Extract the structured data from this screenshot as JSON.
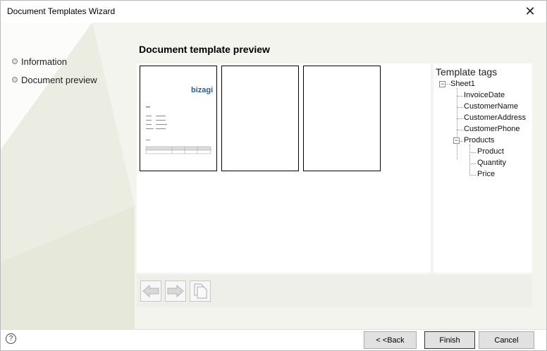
{
  "window": {
    "title": "Document Templates Wizard"
  },
  "nav": {
    "items": [
      {
        "label": "Information"
      },
      {
        "label": "Document preview"
      }
    ]
  },
  "preview": {
    "title": "Document template preview",
    "page1_logo": "bizagi"
  },
  "tags": {
    "title": "Template tags",
    "root": "Sheet1",
    "fields": [
      "InvoiceDate",
      "CustomerName",
      "CustomerAddress",
      "CustomerPhone"
    ],
    "group": "Products",
    "group_fields": [
      "Product",
      "Quantity",
      "Price"
    ]
  },
  "footer": {
    "back_label": "< <Back",
    "finish_label": "Finish",
    "cancel_label": "Cancel",
    "help_glyph": "?"
  }
}
